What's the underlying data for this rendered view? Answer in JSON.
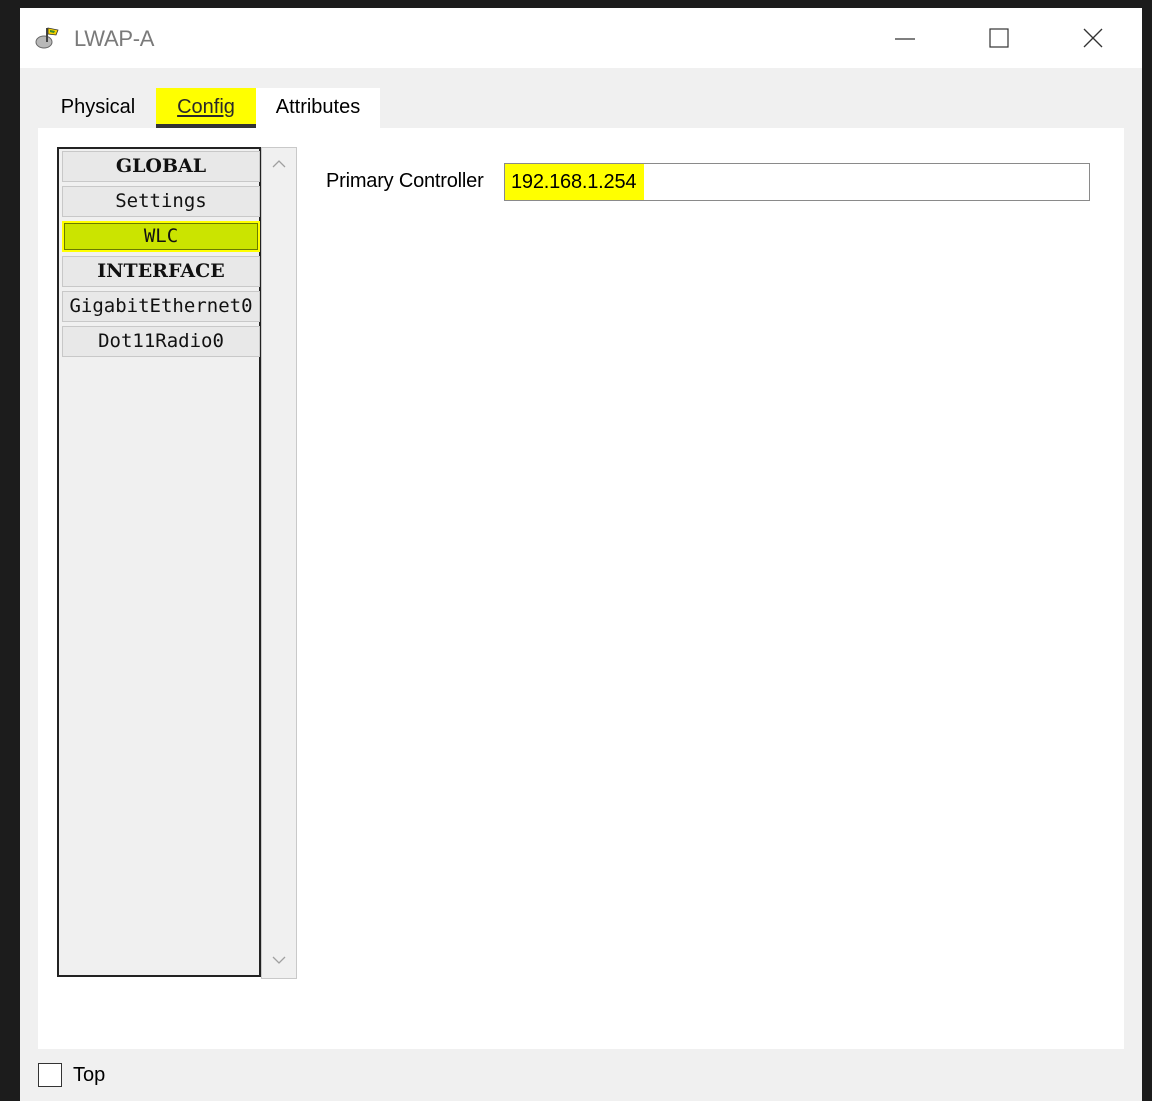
{
  "window": {
    "title": "LWAP-A",
    "icon": "access-point-icon",
    "controls": [
      "minimize-icon",
      "maximize-icon",
      "close-icon"
    ]
  },
  "tabs": [
    {
      "label": "Physical",
      "selected": false
    },
    {
      "label": "Config",
      "selected": true
    },
    {
      "label": "Attributes",
      "selected": false
    }
  ],
  "sidebar": {
    "items": [
      {
        "label": "GLOBAL",
        "type": "header"
      },
      {
        "label": "Settings",
        "type": "item"
      },
      {
        "label": "WLC",
        "type": "item",
        "selected": true
      },
      {
        "label": "INTERFACE",
        "type": "header"
      },
      {
        "label": "GigabitEthernet0",
        "type": "item"
      },
      {
        "label": "Dot11Radio0",
        "type": "item"
      }
    ]
  },
  "wlc": {
    "primary_controller_label": "Primary Controller",
    "primary_controller_value": "192.168.1.254"
  },
  "footer": {
    "top_label": "Top",
    "top_checked": false
  },
  "colors": {
    "highlight": "#ffff00",
    "selected_item": "#cbe400"
  }
}
